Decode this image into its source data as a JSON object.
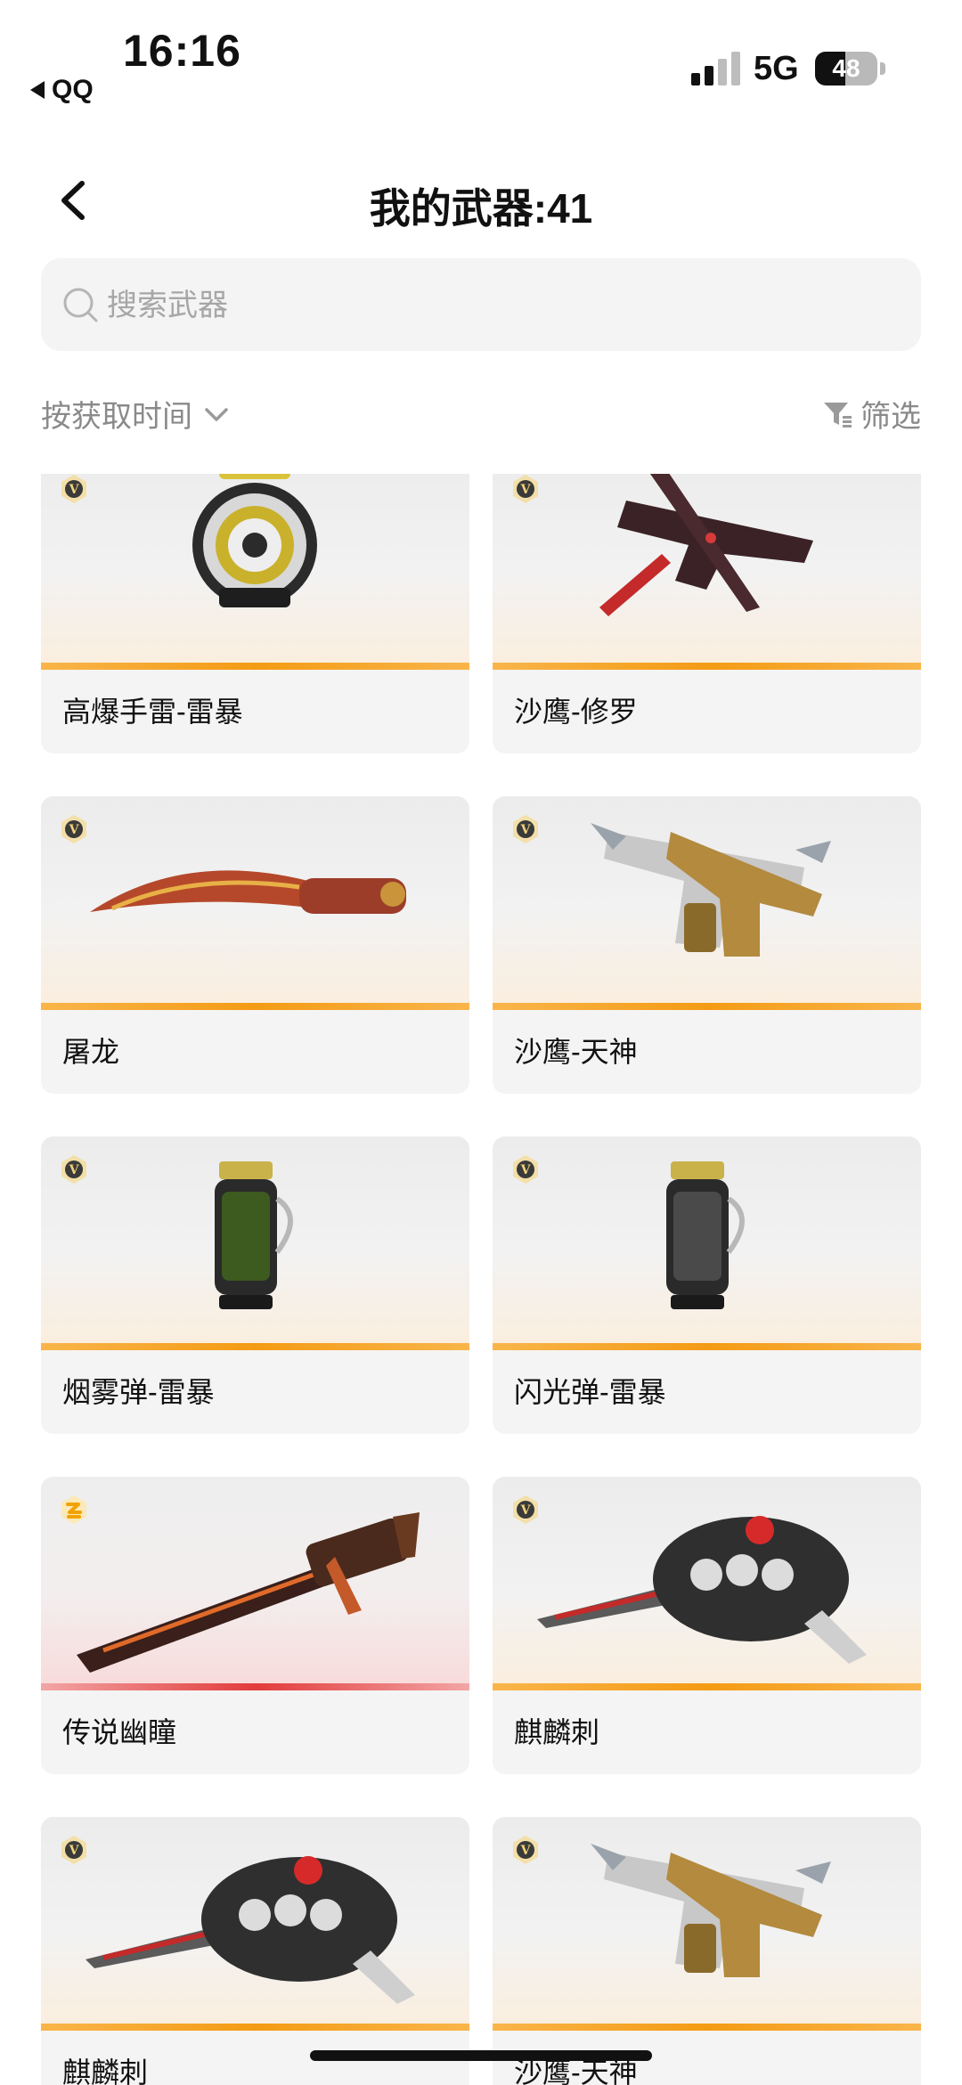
{
  "status": {
    "time": "16:16",
    "back_app": "QQ",
    "network": "5G",
    "battery": "48"
  },
  "nav": {
    "title": "我的武器:41"
  },
  "search": {
    "placeholder": "搜索武器"
  },
  "sort": {
    "label": "按获取时间"
  },
  "filter": {
    "label": "筛选"
  },
  "colors": {
    "rarity_gold": "#f49b14",
    "rarity_red": "#e23b3b",
    "card_bg": "#f4f4f4"
  },
  "weapons": [
    {
      "name": "高爆手雷-雷暴",
      "icon": "grenade-icon",
      "badge": "v-badge-icon",
      "rarity": "gold"
    },
    {
      "name": "沙鹰-修罗",
      "icon": "pistol-icon",
      "badge": "v-badge-icon",
      "rarity": "gold"
    },
    {
      "name": "屠龙",
      "icon": "machete-icon",
      "badge": "v-badge-icon",
      "rarity": "gold"
    },
    {
      "name": "沙鹰-天神",
      "icon": "dual-pistols-icon",
      "badge": "v-badge-icon",
      "rarity": "gold"
    },
    {
      "name": "烟雾弹-雷暴",
      "icon": "smoke-grenade-icon",
      "badge": "v-badge-icon",
      "rarity": "gold"
    },
    {
      "name": "闪光弹-雷暴",
      "icon": "flash-grenade-icon",
      "badge": "v-badge-icon",
      "rarity": "gold"
    },
    {
      "name": "传说幽瞳",
      "icon": "sniper-rifle-icon",
      "badge": "legend-badge-icon",
      "rarity": "red"
    },
    {
      "name": "麒麟刺",
      "icon": "knuckle-blade-icon",
      "badge": "v-badge-icon",
      "rarity": "gold"
    },
    {
      "name": "麒麟刺",
      "icon": "knuckle-blade-icon",
      "badge": "v-badge-icon",
      "rarity": "gold"
    },
    {
      "name": "沙鹰-天神",
      "icon": "dual-pistols-icon",
      "badge": "v-badge-icon",
      "rarity": "gold"
    }
  ]
}
